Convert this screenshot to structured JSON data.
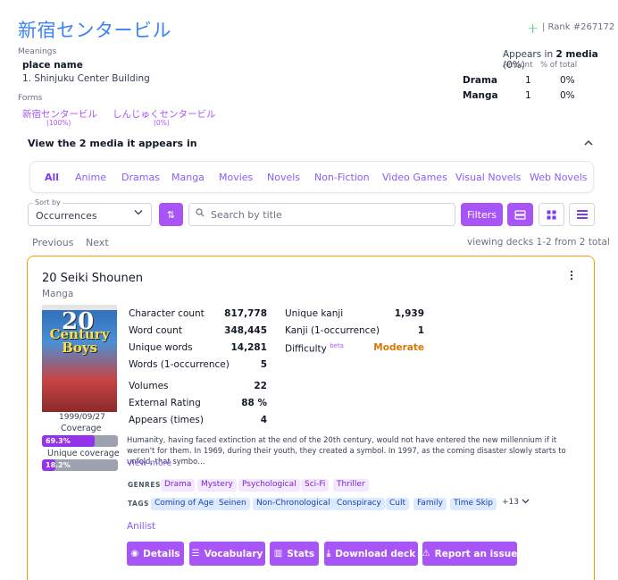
{
  "word": {
    "title": "新宿センタービル",
    "rank": "| Rank #267172",
    "meanings_label": "Meanings",
    "pos": "place name",
    "meaning": "1. Shinjuku Center Building",
    "forms_label": "Forms",
    "forms": [
      {
        "text": "新宿センタービル",
        "pct": "(100%)"
      },
      {
        "text": "しんじゅくセンタービル",
        "pct": "(0%)"
      }
    ]
  },
  "appears": {
    "prefix": "Appears in ",
    "bold": "2 media",
    "suffix": " (0%)",
    "col_amount": "Amount",
    "col_pct": "% of total",
    "rows": [
      {
        "label": "Drama",
        "amount": "1",
        "pct": "0%"
      },
      {
        "label": "Manga",
        "amount": "1",
        "pct": "0%"
      }
    ]
  },
  "view_media": "View the 2 media it appears in",
  "tabs": [
    "All",
    "Anime",
    "Dramas",
    "Manga",
    "Movies",
    "Novels",
    "Non-Fiction",
    "Video Games",
    "Visual Novels",
    "Web Novels"
  ],
  "controls": {
    "sort_label": "Sort by",
    "sort_value": "Occurrences",
    "search_placeholder": "Search by title",
    "filters": "Filters"
  },
  "pagination": {
    "previous": "Previous",
    "next": "Next",
    "viewing": "viewing decks 1-2 from 2 total"
  },
  "deck": {
    "title": "20 Seiki Shounen",
    "type": "Manga",
    "cover_num": "20",
    "cover_title": "Century Boys",
    "release_date": "1999/09/27",
    "coverage_label": "Coverage",
    "coverage": "69.3%",
    "coverage_value": 69.3,
    "unique_coverage_label": "Unique coverage",
    "unique_coverage": "18.2%",
    "unique_coverage_value": 18.2,
    "stats_left": [
      {
        "label": "Character count",
        "value": "817,778"
      },
      {
        "label": "Word count",
        "value": "348,445"
      },
      {
        "label": "Unique words",
        "value": "14,281"
      },
      {
        "label": "Words (1-occurrence)",
        "value": "5"
      },
      {
        "label": "Volumes",
        "value": "22"
      },
      {
        "label": "External Rating",
        "value": "88 %"
      },
      {
        "label": "Appears (times)",
        "value": "4"
      }
    ],
    "stats_right": [
      {
        "label": "Unique kanji",
        "value": "1,939"
      },
      {
        "label": "Kanji (1-occurrence)",
        "value": "1"
      },
      {
        "label": "Difficulty",
        "value": "Moderate"
      }
    ],
    "beta": "beta",
    "description": "Humanity, having faced extinction at the end of the 20th century, would not have entered the new millennium if it weren't for them. In 1969, during their youth, they created a symbol. In 1997, as the coming disaster slowly starts to unfold, that symbo…",
    "view_more": "View more",
    "genres_label": "GENRES",
    "genres": [
      "Drama",
      "Mystery",
      "Psychological",
      "Sci-Fi",
      "Thriller"
    ],
    "tags_label": "TAGS",
    "tags": [
      "Coming of Age",
      "Seinen",
      "Non-Chronological",
      "Conspiracy",
      "Cult",
      "Family",
      "Time Skip"
    ],
    "more_tags": "+13",
    "anilist": "Anilist",
    "actions": [
      {
        "label": "Details",
        "icon": "eye-icon",
        "glyph": "◉"
      },
      {
        "label": "Vocabulary",
        "icon": "list-icon",
        "glyph": "☰"
      },
      {
        "label": "Stats",
        "icon": "bar-chart-icon",
        "glyph": "▥"
      },
      {
        "label": "Download deck",
        "icon": "download-icon",
        "glyph": "⤓"
      },
      {
        "label": "Report an issue",
        "icon": "warning-icon",
        "glyph": "⚠"
      }
    ]
  },
  "colors": {
    "accent": "#a855f7",
    "title_blue": "#3b82f6",
    "card_border": "#f59e0b",
    "moderate": "#d97706"
  }
}
